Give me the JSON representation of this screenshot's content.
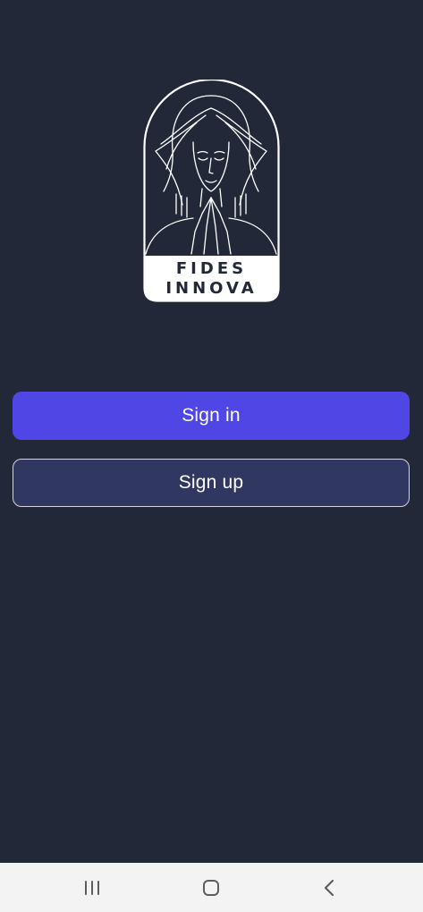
{
  "app": {
    "logo_line1": "FIDES",
    "logo_line2": "INNOVA"
  },
  "auth": {
    "sign_in_label": "Sign in",
    "sign_up_label": "Sign up"
  },
  "colors": {
    "background": "#222838",
    "sign_in_button": "#4f46e5",
    "sign_up_button": "#303760",
    "nav_bar": "#f3f3f3"
  },
  "system_nav": {
    "items": [
      "recents-icon",
      "home-icon",
      "back-icon"
    ]
  }
}
